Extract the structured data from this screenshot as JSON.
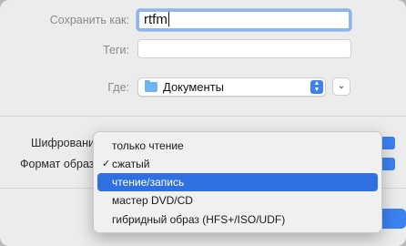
{
  "form": {
    "save_as_label": "Сохранить как:",
    "save_as_value": "rtfm",
    "tags_label": "Теги:",
    "tags_value": "",
    "where_label": "Где:",
    "where_value": "Документы",
    "encryption_label": "Шифровани",
    "format_label": "Формат образ"
  },
  "format_menu": {
    "items": [
      {
        "label": "только чтение",
        "checked": false,
        "selected": false
      },
      {
        "label": "сжатый",
        "checked": true,
        "selected": false
      },
      {
        "label": "чтение/запись",
        "checked": false,
        "selected": true
      },
      {
        "label": "мастер DVD/CD",
        "checked": false,
        "selected": false
      },
      {
        "label": "гибридный образ (HFS+/ISO/UDF)",
        "checked": false,
        "selected": false
      }
    ],
    "check_glyph": "✓"
  },
  "icons": {
    "folder": "folder-icon",
    "stepper": "up-down-chevron-icon",
    "expand": "chevron-down-icon"
  },
  "colors": {
    "accent": "#3b82f0",
    "selection": "#2f6fe0",
    "folder": "#6fb4f0"
  }
}
